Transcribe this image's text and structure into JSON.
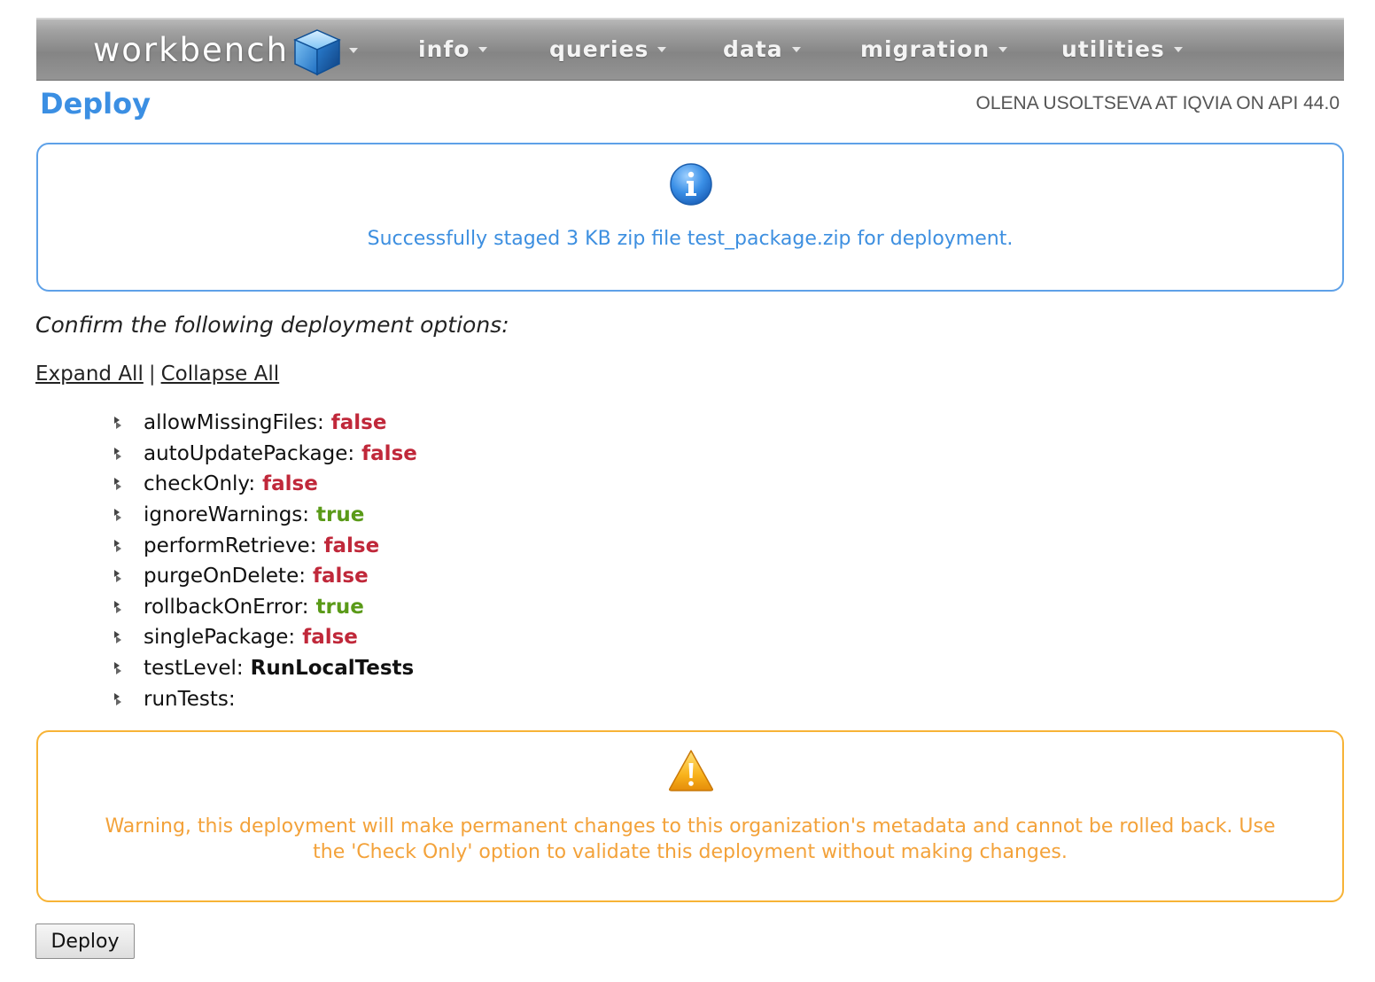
{
  "nav": {
    "logo_text": "workbench",
    "logo_icon": "cube-icon",
    "menus": [
      {
        "label": "info"
      },
      {
        "label": "queries"
      },
      {
        "label": "data"
      },
      {
        "label": "migration"
      },
      {
        "label": "utilities"
      }
    ]
  },
  "header": {
    "title": "Deploy",
    "user_info": "OLENA USOLTSEVA AT IQVIA ON API 44.0"
  },
  "info_box": {
    "icon": "info-icon",
    "message": "Successfully staged 3 KB zip file test_package.zip for deployment."
  },
  "confirm_text": "Confirm the following deployment options:",
  "expand_all": "Expand All",
  "separator": "|",
  "collapse_all": "Collapse All",
  "options": [
    {
      "name": "allowMissingFiles:",
      "value": "false"
    },
    {
      "name": "autoUpdatePackage:",
      "value": "false"
    },
    {
      "name": "checkOnly:",
      "value": "false"
    },
    {
      "name": "ignoreWarnings:",
      "value": "true"
    },
    {
      "name": "performRetrieve:",
      "value": "false"
    },
    {
      "name": "purgeOnDelete:",
      "value": "false"
    },
    {
      "name": "rollbackOnError:",
      "value": "true"
    },
    {
      "name": "singlePackage:",
      "value": "false"
    },
    {
      "name": "testLevel:",
      "value": "RunLocalTests"
    },
    {
      "name": "runTests:",
      "value": ""
    }
  ],
  "warning_box": {
    "icon": "warning-icon",
    "message_line1": "Warning, this deployment will make permanent changes to this organization's metadata and cannot be rolled back. Use",
    "message_line2": "the 'Check Only' option to validate this deployment without making changes."
  },
  "deploy_button": "Deploy",
  "colors": {
    "title_blue": "#3b8fe3",
    "false_red": "#c0283a",
    "true_green": "#5a9a18",
    "warning_orange": "#f3a23a",
    "info_border": "#5ea1e8",
    "warning_border": "#f7b336"
  }
}
